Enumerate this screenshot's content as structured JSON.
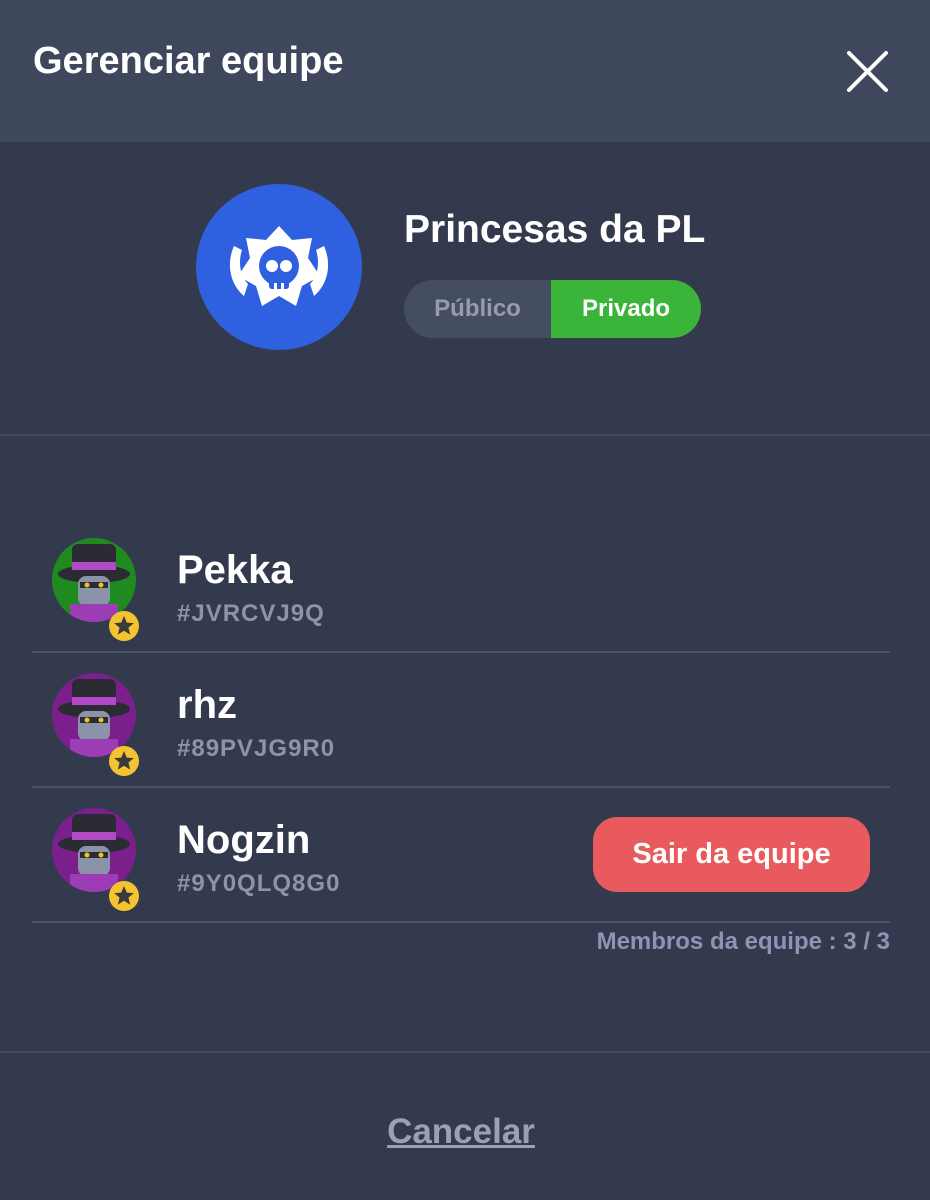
{
  "header": {
    "title": "Gerenciar equipe",
    "close_icon": "close-icon"
  },
  "team": {
    "name": "Princesas da PL",
    "logo_icon": "skull-star-icon",
    "privacy": {
      "options": [
        "Público",
        "Privado"
      ],
      "selected": "Privado"
    }
  },
  "members": [
    {
      "name": "Pekka",
      "tag": "#JVRCVJ9Q",
      "avatar_bg": "#1f8a1f",
      "badge_icon": "star-icon"
    },
    {
      "name": "rhz",
      "tag": "#89PVJG9R0",
      "avatar_bg": "#7a1f8c",
      "badge_icon": "star-icon"
    },
    {
      "name": "Nogzin",
      "tag": "#9Y0QLQ8G0",
      "avatar_bg": "#7a1f8c",
      "badge_icon": "star-icon",
      "action_label": "Sair da equipe"
    }
  ],
  "members_count_label": "Membros da equipe : 3 / 3",
  "footer": {
    "cancel_label": "Cancelar"
  },
  "colors": {
    "background": "#343a4d",
    "header": "#3f475c",
    "accent_green": "#3bb43a",
    "danger_red": "#e85a5d",
    "logo_blue": "#2f60e0"
  }
}
